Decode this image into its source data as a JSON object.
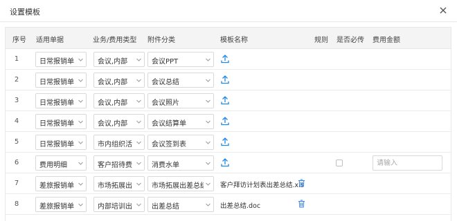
{
  "dialog": {
    "title": "设置模板"
  },
  "columns": [
    "序号",
    "适用单据",
    "业务/费用类型",
    "附件分类",
    "模板名称",
    "规则",
    "是否必传",
    "费用金额"
  ],
  "colors": {
    "accent": "#1e88e5",
    "delete": "#2f80ed",
    "border": "#d9d9d9",
    "header_bg": "#f4f4f4"
  },
  "rows": [
    {
      "idx": "1",
      "doc": "日常报销单",
      "type": "会议,内部",
      "category": "会议PPT",
      "template": "",
      "has_checkbox": false,
      "has_amount": false
    },
    {
      "idx": "2",
      "doc": "日常报销单",
      "type": "会议,内部",
      "category": "会议总结",
      "template": "",
      "has_checkbox": false,
      "has_amount": false
    },
    {
      "idx": "3",
      "doc": "日常报销单",
      "type": "会议,内部",
      "category": "会议照片",
      "template": "",
      "has_checkbox": false,
      "has_amount": false
    },
    {
      "idx": "4",
      "doc": "日常报销单",
      "type": "会议,内部",
      "category": "会议结算单",
      "template": "",
      "has_checkbox": false,
      "has_amount": false
    },
    {
      "idx": "5",
      "doc": "日常报销单",
      "type": "市内组织活",
      "category": "会议签到表",
      "template": "",
      "has_checkbox": false,
      "has_amount": false
    },
    {
      "idx": "6",
      "doc": "费用明细",
      "type": "客户招待费",
      "category": "消费水单",
      "template": "",
      "has_checkbox": true,
      "has_amount": true,
      "amount_placeholder": "请输入"
    },
    {
      "idx": "7",
      "doc": "差旅报销单",
      "type": "市场拓展出",
      "category": "市场拓展出差总结",
      "template": "客户拜访计划表出差总结.xls",
      "has_checkbox": false,
      "has_amount": false
    },
    {
      "idx": "8",
      "doc": "差旅报销单",
      "type": "内部培训出",
      "category": "出差总结",
      "template": "出差总结.doc",
      "has_checkbox": false,
      "has_amount": false
    }
  ]
}
